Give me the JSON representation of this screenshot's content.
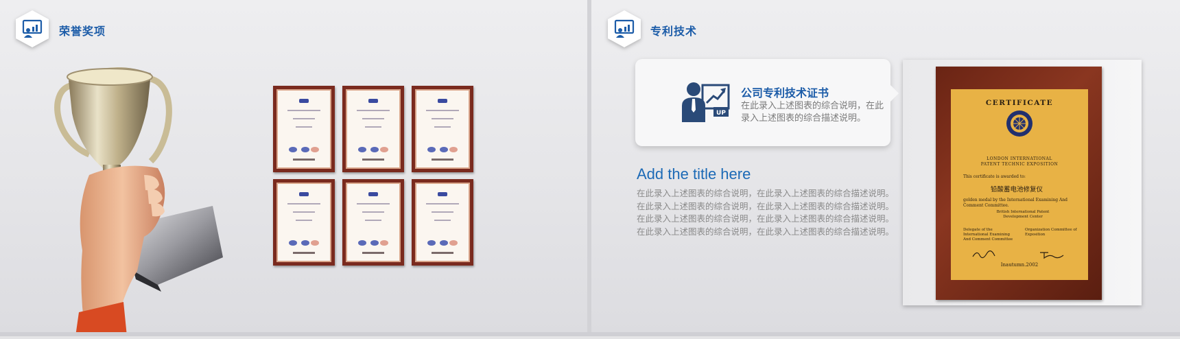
{
  "left_slide": {
    "section_title": "荣誉奖项",
    "badge_icon": "presentation-chart-icon"
  },
  "right_slide": {
    "section_title": "专利技术",
    "badge_icon": "presentation-chart-icon",
    "card": {
      "icon": "person-up-chart-icon",
      "icon_text": "UP",
      "title": "公司专利技术证书",
      "desc": "在此录入上述图表的综合说明，在此录入上述图表的综合描述说明。"
    },
    "add_title": "Add the title here",
    "body_lines": [
      "在此录入上述图表的综合说明，在此录入上述图表的综合描述说明。",
      "在此录入上述图表的综合说明，在此录入上述图表的综合描述说明。",
      "在此录入上述图表的综合说明，在此录入上述图表的综合描述说明。",
      "在此录入上述图表的综合说明，在此录入上述图表的综合描述说明。"
    ],
    "plaque": {
      "title": "CERTIFICATE",
      "org_line1": "LONDON INTERNATIONAL",
      "org_line2": "PATENT TECHNIC EXPOSITION",
      "awarded": "This certificate is awarded to:",
      "product": "铅酸蓄电池修复仪",
      "medal": "golden medal by the International Examining And Comment Committee.",
      "center_line1": "British International Patent",
      "center_line2": "Development Center",
      "delegate": "Delegate of the International Examining And Comment Committee",
      "committee": "Organization Committee of Exposition",
      "place_date": "Inautumn.2002"
    }
  },
  "colors": {
    "accent": "#1c5ca8",
    "text_gray": "#8a8a8a",
    "plaque_gold": "#e8b245",
    "plaque_wood": "#7a2a1e"
  }
}
